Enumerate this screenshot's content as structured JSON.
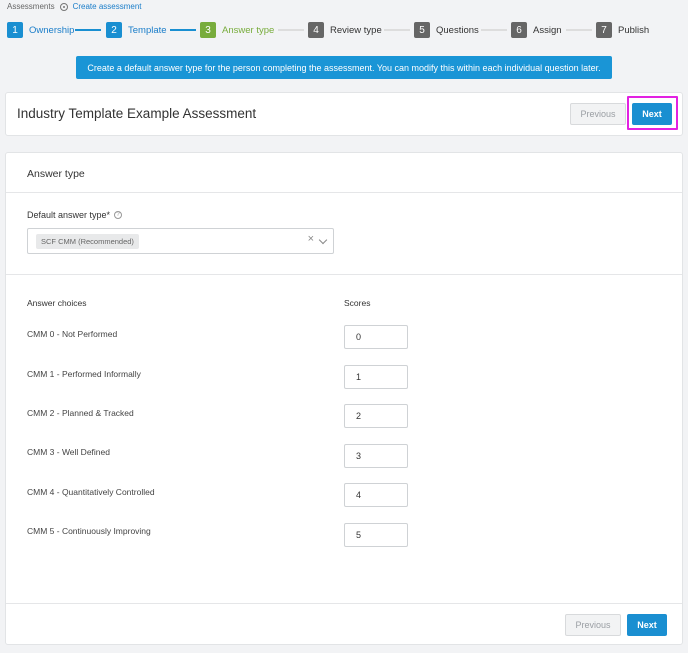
{
  "breadcrumb": {
    "root": "Assessments",
    "current": "Create assessment"
  },
  "stepper": {
    "steps": [
      {
        "num": "1",
        "label": "Ownership",
        "state": "done"
      },
      {
        "num": "2",
        "label": "Template",
        "state": "done"
      },
      {
        "num": "3",
        "label": "Answer type",
        "state": "active"
      },
      {
        "num": "4",
        "label": "Review type",
        "state": "todo"
      },
      {
        "num": "5",
        "label": "Questions",
        "state": "todo"
      },
      {
        "num": "6",
        "label": "Assign",
        "state": "todo"
      },
      {
        "num": "7",
        "label": "Publish",
        "state": "todo"
      }
    ]
  },
  "banner": {
    "text": "Create a default answer type for the person completing the assessment. You can modify this within each individual question later."
  },
  "header": {
    "title": "Industry Template Example Assessment",
    "previous_label": "Previous",
    "next_label": "Next"
  },
  "main": {
    "section_title": "Answer type",
    "default_answer_label": "Default answer type*",
    "selected_value": "SCF CMM (Recommended)",
    "col_choices": "Answer choices",
    "col_scores": "Scores",
    "rows": [
      {
        "label": "CMM 0 - Not Performed",
        "score": "0"
      },
      {
        "label": "CMM 1 - Performed Informally",
        "score": "1"
      },
      {
        "label": "CMM 2 - Planned & Tracked",
        "score": "2"
      },
      {
        "label": "CMM 3 - Well Defined",
        "score": "3"
      },
      {
        "label": "CMM 4 - Quantitatively Controlled",
        "score": "4"
      },
      {
        "label": "CMM 5 - Continuously Improving",
        "score": "5"
      }
    ],
    "footer_previous": "Previous",
    "footer_next": "Next"
  },
  "colors": {
    "primary": "#1a8fd1",
    "active_step": "#78ac3c",
    "todo_step": "#666666",
    "highlight": "#e221e2"
  },
  "icons": {
    "breadcrumb_separator": "circle-dot-icon",
    "info": "info-icon",
    "clear": "close-icon",
    "dropdown": "chevron-down-icon"
  }
}
